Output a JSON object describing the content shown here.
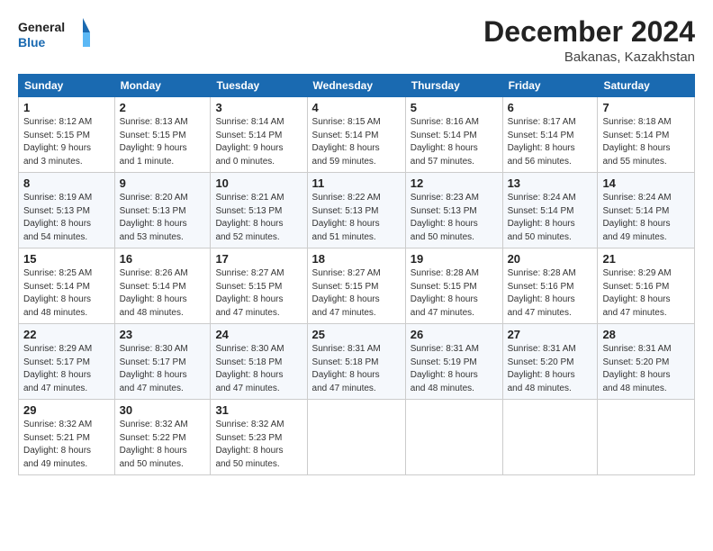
{
  "header": {
    "logo_line1": "General",
    "logo_line2": "Blue",
    "month": "December 2024",
    "location": "Bakanas, Kazakhstan"
  },
  "weekdays": [
    "Sunday",
    "Monday",
    "Tuesday",
    "Wednesday",
    "Thursday",
    "Friday",
    "Saturday"
  ],
  "weeks": [
    [
      {
        "day": "1",
        "info": "Sunrise: 8:12 AM\nSunset: 5:15 PM\nDaylight: 9 hours\nand 3 minutes."
      },
      {
        "day": "2",
        "info": "Sunrise: 8:13 AM\nSunset: 5:15 PM\nDaylight: 9 hours\nand 1 minute."
      },
      {
        "day": "3",
        "info": "Sunrise: 8:14 AM\nSunset: 5:14 PM\nDaylight: 9 hours\nand 0 minutes."
      },
      {
        "day": "4",
        "info": "Sunrise: 8:15 AM\nSunset: 5:14 PM\nDaylight: 8 hours\nand 59 minutes."
      },
      {
        "day": "5",
        "info": "Sunrise: 8:16 AM\nSunset: 5:14 PM\nDaylight: 8 hours\nand 57 minutes."
      },
      {
        "day": "6",
        "info": "Sunrise: 8:17 AM\nSunset: 5:14 PM\nDaylight: 8 hours\nand 56 minutes."
      },
      {
        "day": "7",
        "info": "Sunrise: 8:18 AM\nSunset: 5:14 PM\nDaylight: 8 hours\nand 55 minutes."
      }
    ],
    [
      {
        "day": "8",
        "info": "Sunrise: 8:19 AM\nSunset: 5:13 PM\nDaylight: 8 hours\nand 54 minutes."
      },
      {
        "day": "9",
        "info": "Sunrise: 8:20 AM\nSunset: 5:13 PM\nDaylight: 8 hours\nand 53 minutes."
      },
      {
        "day": "10",
        "info": "Sunrise: 8:21 AM\nSunset: 5:13 PM\nDaylight: 8 hours\nand 52 minutes."
      },
      {
        "day": "11",
        "info": "Sunrise: 8:22 AM\nSunset: 5:13 PM\nDaylight: 8 hours\nand 51 minutes."
      },
      {
        "day": "12",
        "info": "Sunrise: 8:23 AM\nSunset: 5:13 PM\nDaylight: 8 hours\nand 50 minutes."
      },
      {
        "day": "13",
        "info": "Sunrise: 8:24 AM\nSunset: 5:14 PM\nDaylight: 8 hours\nand 50 minutes."
      },
      {
        "day": "14",
        "info": "Sunrise: 8:24 AM\nSunset: 5:14 PM\nDaylight: 8 hours\nand 49 minutes."
      }
    ],
    [
      {
        "day": "15",
        "info": "Sunrise: 8:25 AM\nSunset: 5:14 PM\nDaylight: 8 hours\nand 48 minutes."
      },
      {
        "day": "16",
        "info": "Sunrise: 8:26 AM\nSunset: 5:14 PM\nDaylight: 8 hours\nand 48 minutes."
      },
      {
        "day": "17",
        "info": "Sunrise: 8:27 AM\nSunset: 5:15 PM\nDaylight: 8 hours\nand 47 minutes."
      },
      {
        "day": "18",
        "info": "Sunrise: 8:27 AM\nSunset: 5:15 PM\nDaylight: 8 hours\nand 47 minutes."
      },
      {
        "day": "19",
        "info": "Sunrise: 8:28 AM\nSunset: 5:15 PM\nDaylight: 8 hours\nand 47 minutes."
      },
      {
        "day": "20",
        "info": "Sunrise: 8:28 AM\nSunset: 5:16 PM\nDaylight: 8 hours\nand 47 minutes."
      },
      {
        "day": "21",
        "info": "Sunrise: 8:29 AM\nSunset: 5:16 PM\nDaylight: 8 hours\nand 47 minutes."
      }
    ],
    [
      {
        "day": "22",
        "info": "Sunrise: 8:29 AM\nSunset: 5:17 PM\nDaylight: 8 hours\nand 47 minutes."
      },
      {
        "day": "23",
        "info": "Sunrise: 8:30 AM\nSunset: 5:17 PM\nDaylight: 8 hours\nand 47 minutes."
      },
      {
        "day": "24",
        "info": "Sunrise: 8:30 AM\nSunset: 5:18 PM\nDaylight: 8 hours\nand 47 minutes."
      },
      {
        "day": "25",
        "info": "Sunrise: 8:31 AM\nSunset: 5:18 PM\nDaylight: 8 hours\nand 47 minutes."
      },
      {
        "day": "26",
        "info": "Sunrise: 8:31 AM\nSunset: 5:19 PM\nDaylight: 8 hours\nand 48 minutes."
      },
      {
        "day": "27",
        "info": "Sunrise: 8:31 AM\nSunset: 5:20 PM\nDaylight: 8 hours\nand 48 minutes."
      },
      {
        "day": "28",
        "info": "Sunrise: 8:31 AM\nSunset: 5:20 PM\nDaylight: 8 hours\nand 48 minutes."
      }
    ],
    [
      {
        "day": "29",
        "info": "Sunrise: 8:32 AM\nSunset: 5:21 PM\nDaylight: 8 hours\nand 49 minutes."
      },
      {
        "day": "30",
        "info": "Sunrise: 8:32 AM\nSunset: 5:22 PM\nDaylight: 8 hours\nand 50 minutes."
      },
      {
        "day": "31",
        "info": "Sunrise: 8:32 AM\nSunset: 5:23 PM\nDaylight: 8 hours\nand 50 minutes."
      },
      null,
      null,
      null,
      null
    ]
  ]
}
